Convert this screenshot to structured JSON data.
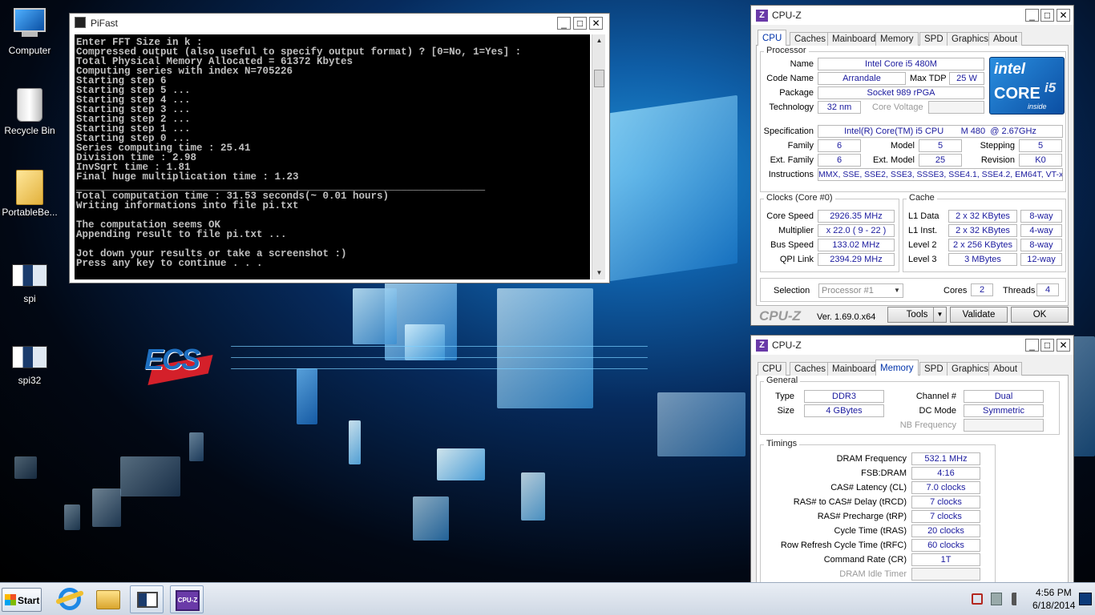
{
  "desktop": {
    "icons": [
      {
        "label": "Computer",
        "icon": "computer-icon"
      },
      {
        "label": "Recycle Bin",
        "icon": "recycle-bin-icon"
      },
      {
        "label": "PortableBe...",
        "icon": "folder-icon"
      },
      {
        "label": "spi",
        "icon": "app-icon"
      },
      {
        "label": "spi32",
        "icon": "app-icon"
      }
    ],
    "wallpaper_logo": "ECS"
  },
  "pifast": {
    "title": "PiFast",
    "console_lines": [
      "Enter FFT Size in k :",
      "Compressed output (also useful to specify output format) ? [0=No, 1=Yes] :",
      "Total Physical Memory Allocated = 61372 Kbytes",
      "Computing series with index N=705226",
      "Starting step 6",
      "Starting step 5 ...",
      "Starting step 4 ...",
      "Starting step 3 ...",
      "Starting step 2 ...",
      "Starting step 1 ...",
      "Starting step 0 ...",
      "Series computing time : 25.41",
      "Division time : 2.98",
      "InvSqrt time : 1.81",
      "Final huge multiplication time : 1.23",
      "____________________________________________________________________",
      "Total computation time : 31.53 seconds(~ 0.01 hours)",
      "Writing informations into file pi.txt",
      "",
      "The computation seems OK",
      "Appending result to file pi.txt ...",
      "",
      "Jot down your results or take a screenshot :)",
      "Press any key to continue . . ."
    ]
  },
  "cpuz_cpu": {
    "title": "CPU-Z",
    "tabs": [
      "CPU",
      "Caches",
      "Mainboard",
      "Memory",
      "SPD",
      "Graphics",
      "About"
    ],
    "active_tab": "CPU",
    "processor_group": "Processor",
    "name_label": "Name",
    "name": "Intel Core i5 480M",
    "codename_label": "Code Name",
    "codename": "Arrandale",
    "maxtdp_label": "Max TDP",
    "maxtdp": "25 W",
    "package_label": "Package",
    "package": "Socket 989 rPGA",
    "technology_label": "Technology",
    "technology": "32 nm",
    "corevoltage_label": "Core Voltage",
    "corevoltage": "",
    "spec_label": "Specification",
    "spec": "Intel(R) Core(TM) i5 CPU       M 480  @ 2.67GHz",
    "family_label": "Family",
    "family": "6",
    "model_label": "Model",
    "model": "5",
    "stepping_label": "Stepping",
    "stepping": "5",
    "extfamily_label": "Ext. Family",
    "extfamily": "6",
    "extmodel_label": "Ext. Model",
    "extmodel": "25",
    "revision_label": "Revision",
    "revision": "K0",
    "instructions_label": "Instructions",
    "instructions": "MMX, SSE, SSE2, SSE3, SSSE3, SSE4.1, SSE4.2, EM64T, VT-x",
    "logo_brand": "intel",
    "logo_core": "CORE",
    "logo_model": "i5",
    "logo_inside": "inside",
    "clocks_group": "Clocks (Core #0)",
    "corespeed_label": "Core Speed",
    "corespeed": "2926.35 MHz",
    "multiplier_label": "Multiplier",
    "multiplier": "x 22.0 ( 9 - 22 )",
    "busspeed_label": "Bus Speed",
    "busspeed": "133.02 MHz",
    "qpilink_label": "QPI Link",
    "qpilink": "2394.29 MHz",
    "cache_group": "Cache",
    "l1data_label": "L1 Data",
    "l1data": "2 x 32 KBytes",
    "l1data_way": "8-way",
    "l1inst_label": "L1 Inst.",
    "l1inst": "2 x 32 KBytes",
    "l1inst_way": "4-way",
    "l2_label": "Level 2",
    "l2": "2 x 256 KBytes",
    "l2_way": "8-way",
    "l3_label": "Level 3",
    "l3": "3 MBytes",
    "l3_way": "12-way",
    "selection_label": "Selection",
    "selection": "Processor #1",
    "cores_label": "Cores",
    "cores": "2",
    "threads_label": "Threads",
    "threads": "4",
    "brand": "CPU-Z",
    "version": "Ver. 1.69.0.x64",
    "tools_label": "Tools",
    "validate_label": "Validate",
    "ok_label": "OK"
  },
  "cpuz_mem": {
    "title": "CPU-Z",
    "tabs": [
      "CPU",
      "Caches",
      "Mainboard",
      "Memory",
      "SPD",
      "Graphics",
      "About"
    ],
    "active_tab": "Memory",
    "general_group": "General",
    "type_label": "Type",
    "type": "DDR3",
    "size_label": "Size",
    "size": "4 GBytes",
    "channel_label": "Channel #",
    "channel": "Dual",
    "dcmode_label": "DC Mode",
    "dcmode": "Symmetric",
    "nbfreq_label": "NB Frequency",
    "nbfreq": "",
    "timings_group": "Timings",
    "timings": [
      {
        "label": "DRAM Frequency",
        "value": "532.1 MHz"
      },
      {
        "label": "FSB:DRAM",
        "value": "4:16"
      },
      {
        "label": "CAS# Latency (CL)",
        "value": "7.0 clocks"
      },
      {
        "label": "RAS# to CAS# Delay (tRCD)",
        "value": "7 clocks"
      },
      {
        "label": "RAS# Precharge (tRP)",
        "value": "7 clocks"
      },
      {
        "label": "Cycle Time (tRAS)",
        "value": "20 clocks"
      },
      {
        "label": "Row Refresh Cycle Time (tRFC)",
        "value": "60 clocks"
      },
      {
        "label": "Command Rate (CR)",
        "value": "1T"
      },
      {
        "label": "DRAM Idle Timer",
        "value": ""
      }
    ]
  },
  "taskbar": {
    "start_label": "Start",
    "pinned": [
      "internet-explorer-icon",
      "explorer-folder-icon",
      "pifast-console-icon",
      "cpuz-icon"
    ],
    "cpuz_badge": "CPU-Z",
    "time": "4:56 PM",
    "date": "6/18/2014"
  }
}
